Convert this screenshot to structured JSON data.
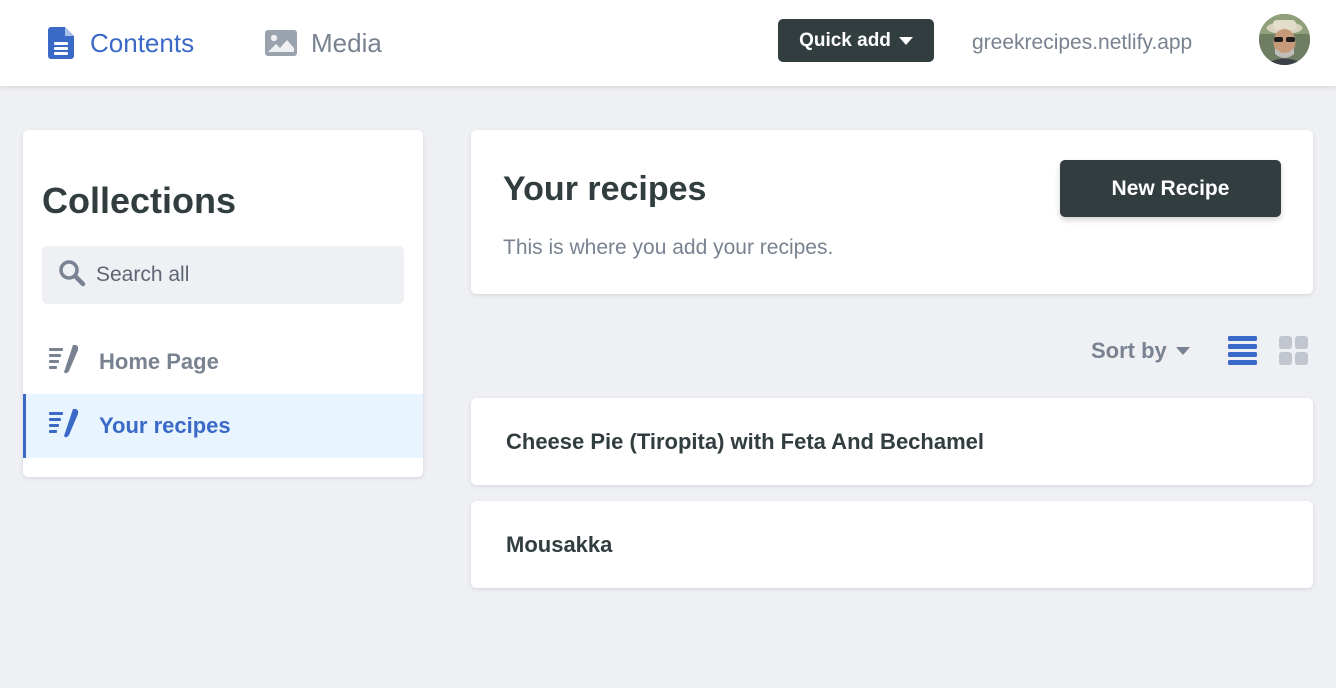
{
  "header": {
    "nav": {
      "contents_label": "Contents",
      "media_label": "Media"
    },
    "quick_add_label": "Quick add",
    "site_url": "greekrecipes.netlify.app"
  },
  "sidebar": {
    "title": "Collections",
    "search_placeholder": "Search all",
    "items": [
      {
        "label": "Home Page",
        "active": false
      },
      {
        "label": "Your recipes",
        "active": true
      }
    ]
  },
  "main": {
    "title": "Your recipes",
    "description": "This is where you add your recipes.",
    "new_button_label": "New Recipe",
    "sort_label": "Sort by",
    "view_mode": "list",
    "entries": [
      {
        "title": "Cheese Pie (Tiropita) with Feta And Bechamel"
      },
      {
        "title": "Mousakka"
      }
    ]
  },
  "colors": {
    "accent": "#3a69c7",
    "dark": "#313d3e",
    "muted": "#798291",
    "background": "#eff0f4",
    "active_item_bg": "#e8f5fe"
  },
  "icons": {
    "contents": "document-icon",
    "media": "image-icon",
    "search": "search-icon",
    "collection": "collection-icon",
    "list_view": "list-view-icon",
    "grid_view": "grid-view-icon"
  }
}
